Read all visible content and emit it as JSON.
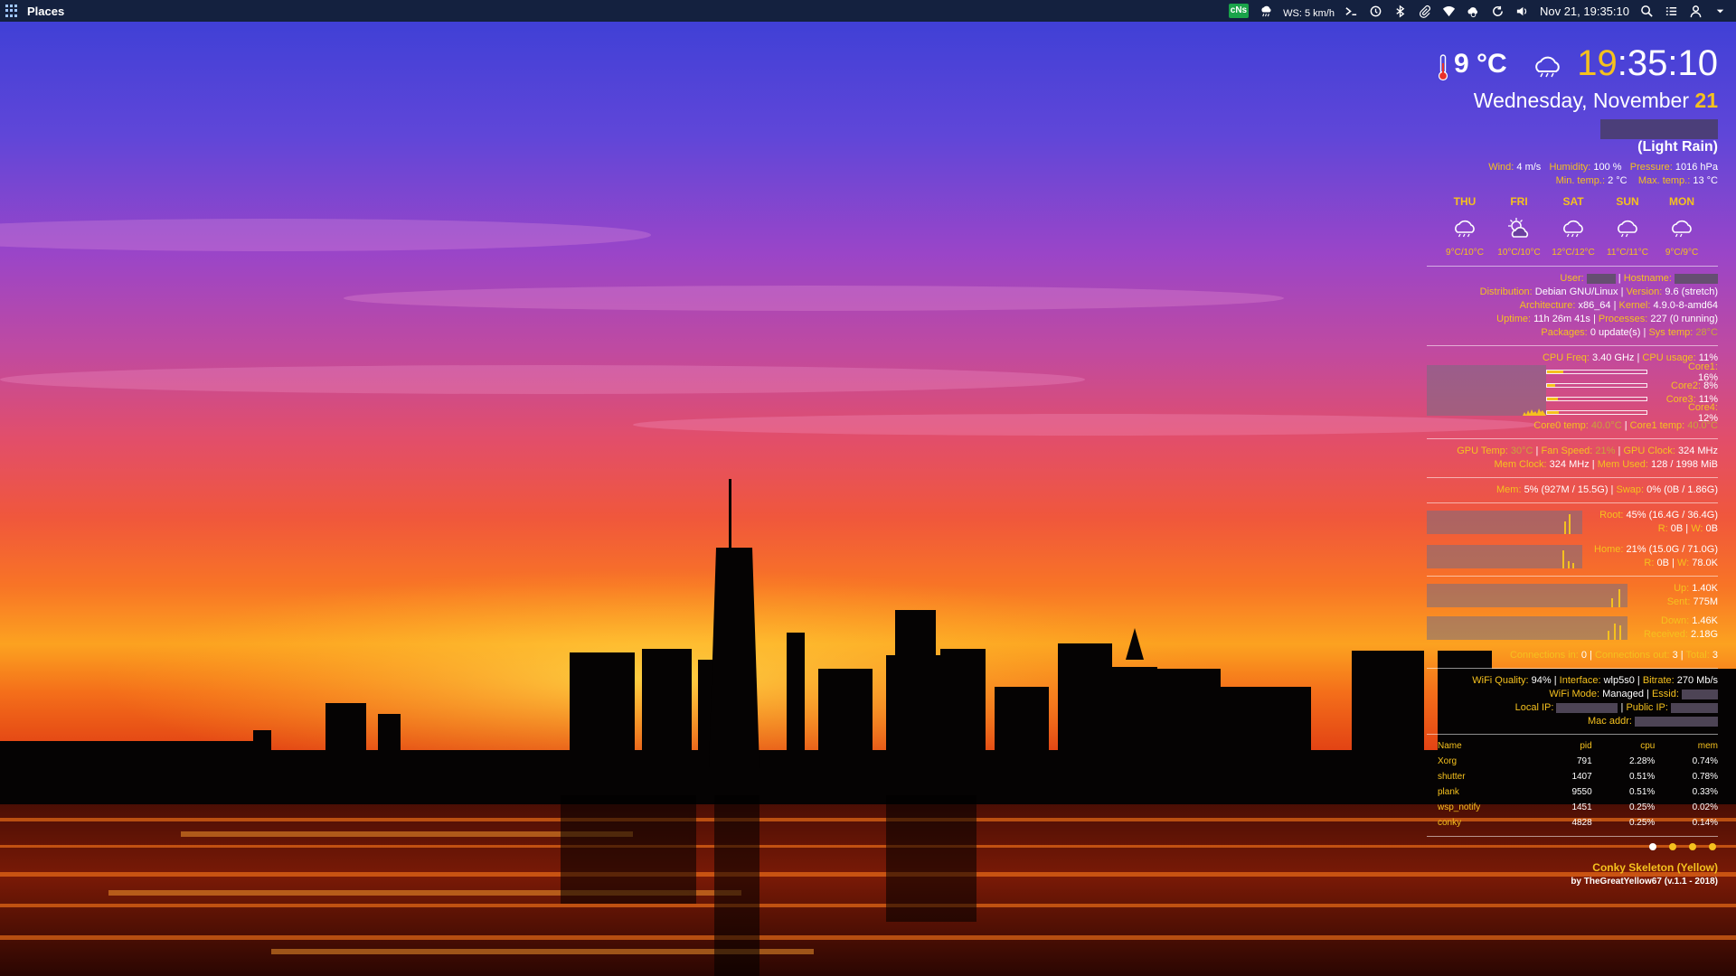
{
  "panel": {
    "places_label": "Places",
    "ws_text": "WS: 5 km/h",
    "cns_label": "cNs",
    "datetime": "Nov 21, 19:35:10",
    "tray_icons": [
      "cns-indicator",
      "weather-rain-icon",
      "terminal-icon",
      "history-icon",
      "bluetooth-icon",
      "paperclip-icon",
      "wifi-icon",
      "cloud-sync-icon",
      "refresh-icon",
      "volume-icon",
      "search-icon",
      "menu-list-icon",
      "user-icon",
      "chevron-down-icon"
    ]
  },
  "conky": {
    "temp": "9 °C",
    "clock_hour": "19",
    "clock_rest": ":35:10",
    "date_prefix": "Wednesday, November ",
    "date_day": "21",
    "condition": "(Light Rain)",
    "weather": {
      "wind_label": "Wind:",
      "wind": "4 m/s",
      "humidity_label": "Humidity:",
      "humidity": "100 %",
      "pressure_label": "Pressure:",
      "pressure": "1016 hPa",
      "min_label": "Min. temp.:",
      "min": "2 °C",
      "max_label": "Max. temp.:",
      "max": "13 °C"
    },
    "forecast": [
      {
        "day": "THU",
        "temps": "9°C/10°C",
        "icon": "rain-cloud-icon"
      },
      {
        "day": "FRI",
        "temps": "10°C/10°C",
        "icon": "sun-cloud-icon"
      },
      {
        "day": "SAT",
        "temps": "12°C/12°C",
        "icon": "rain-cloud-icon"
      },
      {
        "day": "SUN",
        "temps": "11°C/11°C",
        "icon": "rain-cloud-icon"
      },
      {
        "day": "MON",
        "temps": "9°C/9°C",
        "icon": "rain-cloud-icon"
      }
    ],
    "system": {
      "user_label": "User:",
      "hostname_label": "Hostname:",
      "distribution_label": "Distribution:",
      "distribution": "Debian GNU/Linux",
      "version_label": "Version:",
      "version": "9.6 (stretch)",
      "arch_label": "Architecture:",
      "arch": "x86_64",
      "kernel_label": "Kernel:",
      "kernel": "4.9.0-8-amd64",
      "uptime_label": "Uptime:",
      "uptime": "11h 26m 41s",
      "processes_label": "Processes:",
      "processes": "227 (0 running)",
      "packages_label": "Packages:",
      "packages": "0 update(s)",
      "systemp_label": "Sys temp:",
      "systemp": "28°C"
    },
    "cpu": {
      "freq_label": "CPU Freq:",
      "freq": "3.40 GHz",
      "usage_label": "CPU usage:",
      "usage": "11%",
      "cores": [
        {
          "label": "Core1:",
          "value": "16%",
          "fraction": 0.16
        },
        {
          "label": "Core2:",
          "value": "8%",
          "fraction": 0.08
        },
        {
          "label": "Core3:",
          "value": "11%",
          "fraction": 0.11
        },
        {
          "label": "Core4:",
          "value": "12%",
          "fraction": 0.12
        }
      ],
      "core0_label": "Core0 temp:",
      "core0": "40.0°C",
      "core1_label": "Core1 temp:",
      "core1": "40.0°C"
    },
    "gpu": {
      "temp_label": "GPU Temp:",
      "temp": "30°C",
      "fan_label": "Fan Speed:",
      "fan": "21%",
      "clock_label": "GPU Clock:",
      "clock": "324 MHz",
      "memclock_label": "Mem Clock:",
      "memclock": "324 MHz",
      "memused_label": "Mem Used:",
      "memused": "128 / 1998 MiB"
    },
    "memory": {
      "mem_label": "Mem:",
      "mem": "5% (927M / 15.5G)",
      "swap_label": "Swap:",
      "swap": "0% (0B / 1.86G)"
    },
    "disks": {
      "root_label": "Root:",
      "root": "45% (16.4G / 36.4G)",
      "root_r_label": "R:",
      "root_r": "0B",
      "root_w_label": "W:",
      "root_w": "0B",
      "home_label": "Home:",
      "home": "21% (15.0G / 71.0G)",
      "home_r_label": "R:",
      "home_r": "0B",
      "home_w_label": "W:",
      "home_w": "78.0K"
    },
    "network": {
      "up_label": "Up:",
      "up": "1.40K",
      "sent_label": "Sent:",
      "sent": "775M",
      "down_label": "Down:",
      "down": "1.46K",
      "received_label": "Received:",
      "received": "2.18G",
      "conn_in_label": "Connections in:",
      "conn_in": "0",
      "conn_out_label": "Connections out:",
      "conn_out": "3",
      "total_label": "Total:",
      "total": "3",
      "wifi_quality_label": "WiFi Quality:",
      "wifi_quality": "94%",
      "interface_label": "Interface:",
      "interface": "wlp5s0",
      "bitrate_label": "Bitrate:",
      "bitrate": "270 Mb/s",
      "wifi_mode_label": "WiFi Mode:",
      "wifi_mode": "Managed",
      "essid_label": "Essid:",
      "local_ip_label": "Local IP:",
      "public_ip_label": "Public IP:",
      "mac_label": "Mac addr:"
    },
    "processes_table": {
      "headers": [
        "Name",
        "pid",
        "cpu",
        "mem"
      ],
      "rows": [
        [
          "Xorg",
          "791",
          "2.28%",
          "0.74%"
        ],
        [
          "shutter",
          "1407",
          "0.51%",
          "0.78%"
        ],
        [
          "plank",
          "9550",
          "0.51%",
          "0.33%"
        ],
        [
          "wsp_notify",
          "1451",
          "0.25%",
          "0.02%"
        ],
        [
          "conky",
          "4828",
          "0.25%",
          "0.14%"
        ]
      ]
    },
    "footer": {
      "title": "Conky Skeleton (Yellow)",
      "byline": "by TheGreatYellow67 (v.1.1 - 2018)"
    }
  }
}
